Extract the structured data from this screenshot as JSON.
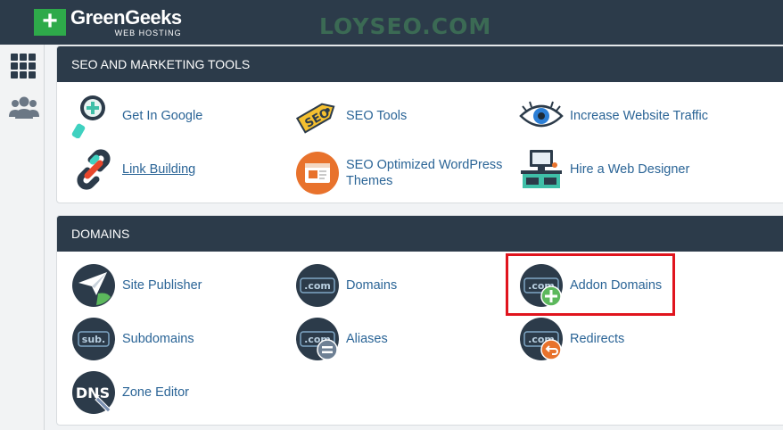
{
  "brand": {
    "name": "GreenGeeks",
    "tagline": "WEB HOSTING",
    "logo_mark": "+"
  },
  "watermark": "LOYSEO.COM",
  "sidebar": {
    "items": [
      {
        "icon": "grid-icon"
      },
      {
        "icon": "users-icon"
      }
    ]
  },
  "sections": [
    {
      "title": "SEO AND MARKETING TOOLS",
      "items": [
        {
          "label": "Get In Google",
          "icon": "magnifier-plus-icon"
        },
        {
          "label": "SEO Tools",
          "icon": "seo-tag-icon"
        },
        {
          "label": "Increase Website Traffic",
          "icon": "eye-icon"
        },
        {
          "label": "Link Building",
          "icon": "chain-link-icon",
          "hover": true
        },
        {
          "label": "SEO Optimized WordPress Themes",
          "icon": "browser-window-icon"
        },
        {
          "label": "Hire a Web Designer",
          "icon": "web-designer-desk-icon"
        }
      ]
    },
    {
      "title": "DOMAINS",
      "items": [
        {
          "label": "Site Publisher",
          "icon": "paper-plane-icon"
        },
        {
          "label": "Domains",
          "icon": "dotcom-icon",
          "badge": ".com"
        },
        {
          "label": "Addon Domains",
          "icon": "dotcom-plus-icon",
          "badge": ".com",
          "highlighted": true
        },
        {
          "label": "Subdomains",
          "icon": "subdomain-icon",
          "badge": "sub."
        },
        {
          "label": "Aliases",
          "icon": "dotcom-equals-icon",
          "badge": ".com"
        },
        {
          "label": "Redirects",
          "icon": "dotcom-redirect-icon",
          "badge": ".com"
        },
        {
          "label": "Zone Editor",
          "icon": "dns-icon",
          "badge": "DNS"
        }
      ]
    }
  ],
  "colors": {
    "header": "#2c3b4a",
    "link": "#2a6496",
    "brand_green": "#2eaa4a",
    "highlight": "#e0141d",
    "badge_green": "#5cb85c",
    "badge_orange": "#e8722c"
  }
}
